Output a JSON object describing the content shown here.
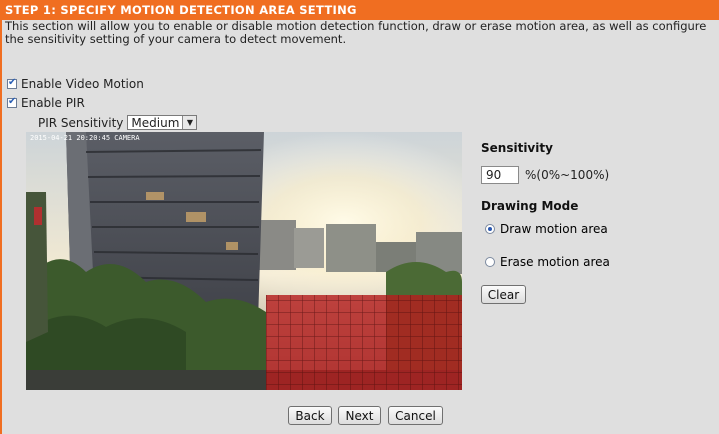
{
  "header": {
    "title": "STEP 1: SPECIFY MOTION DETECTION AREA SETTING"
  },
  "description": "This section will allow you to enable or disable motion detection function, draw or erase motion area, as well as configure the sensitivity setting of your camera to detect movement.",
  "options": {
    "enable_video_motion": {
      "label": "Enable Video Motion",
      "checked": true
    },
    "enable_pir": {
      "label": "Enable PIR",
      "checked": true
    }
  },
  "pir": {
    "label": "PIR Sensitivity",
    "value": "Medium"
  },
  "video": {
    "overlay_text": "2015-04-21 20:20:45 CAMERA"
  },
  "sensitivity": {
    "label": "Sensitivity",
    "value": "90",
    "unit": "%(0%~100%)"
  },
  "drawing_mode": {
    "label": "Drawing Mode",
    "options": [
      "Draw motion area",
      "Erase motion area"
    ],
    "selected": "Draw motion area"
  },
  "buttons": {
    "clear": "Clear",
    "back": "Back",
    "next": "Next",
    "cancel": "Cancel"
  },
  "colors": {
    "header": "#f06e21",
    "panel": "#dfdfdf",
    "motion_area": "#b41e1e"
  }
}
